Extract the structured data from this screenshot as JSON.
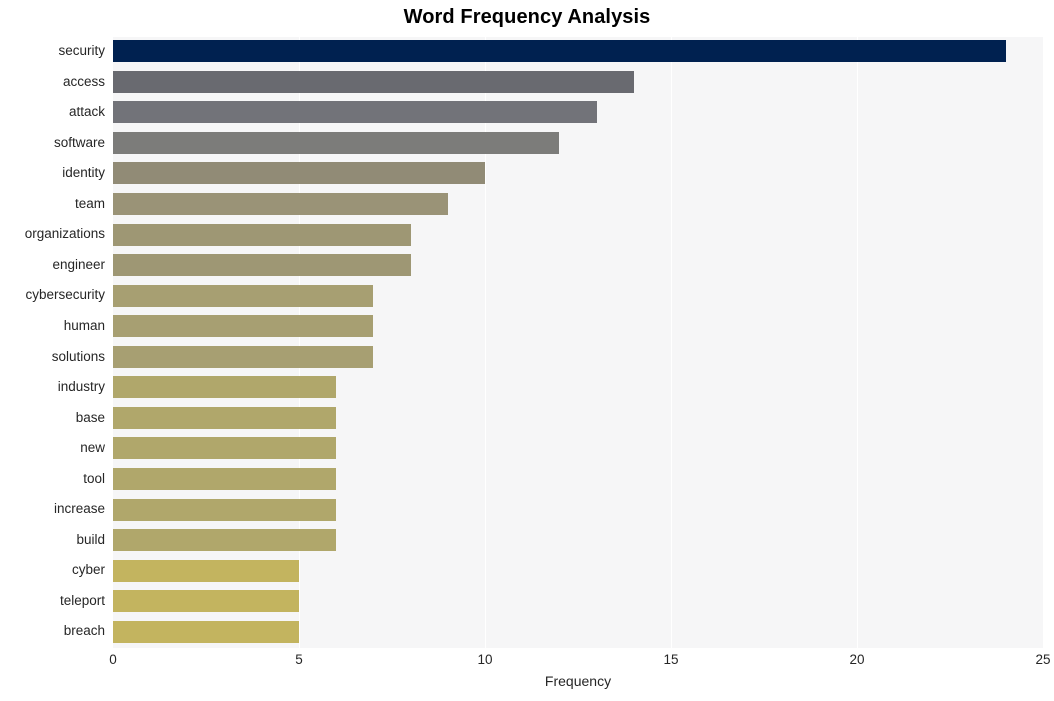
{
  "chart_data": {
    "type": "bar",
    "orientation": "horizontal",
    "title": "Word Frequency Analysis",
    "xlabel": "Frequency",
    "ylabel": "",
    "categories": [
      "security",
      "access",
      "attack",
      "software",
      "identity",
      "team",
      "organizations",
      "engineer",
      "cybersecurity",
      "human",
      "solutions",
      "industry",
      "base",
      "new",
      "tool",
      "increase",
      "build",
      "cyber",
      "teleport",
      "breach"
    ],
    "values": [
      24,
      14,
      13,
      12,
      10,
      9,
      8,
      8,
      7,
      7,
      7,
      6,
      6,
      6,
      6,
      6,
      6,
      5,
      5,
      5
    ],
    "bar_colors": [
      "#002150",
      "#696a70",
      "#727379",
      "#7c7c7a",
      "#918b76",
      "#9a9377",
      "#9e9774",
      "#9e9774",
      "#a79f72",
      "#a79f72",
      "#a79f72",
      "#b0a76b",
      "#b0a76b",
      "#b0a76b",
      "#b0a76b",
      "#b0a76b",
      "#b0a76b",
      "#c3b45f",
      "#c3b45f",
      "#c3b45f"
    ],
    "xlim": [
      0,
      25
    ],
    "xticks": [
      0,
      5,
      10,
      15,
      20,
      25
    ],
    "xtick_labels": [
      "0",
      "5",
      "10",
      "15",
      "20",
      "25"
    ],
    "grid": true,
    "grid_axis": "x",
    "legend": null,
    "plot_background": "#f6f6f7",
    "figure_background": "#ffffff",
    "gridline_color": "#ffffff"
  }
}
